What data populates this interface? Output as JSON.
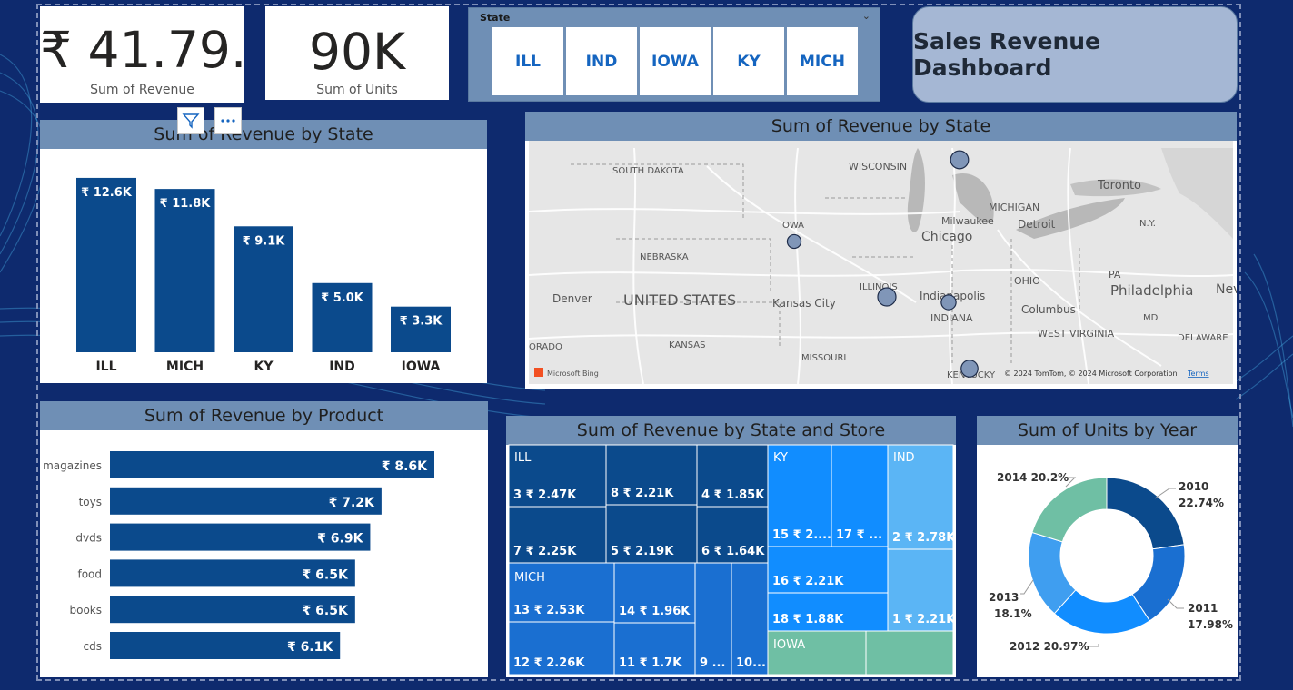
{
  "kpis": [
    {
      "value": "₹ 41.79...",
      "label": "Sum of Revenue"
    },
    {
      "value": "90K",
      "label": "Sum of Units"
    }
  ],
  "slicer": {
    "label": "State",
    "options": [
      "ILL",
      "IND",
      "IOWA",
      "KY",
      "MICH"
    ]
  },
  "dashboard_title": "Sales Revenue Dashboard",
  "icons": {
    "filter": "filter-icon",
    "more": "more-options-icon",
    "chevron": "chevron-down-icon"
  },
  "map": {
    "title": "Sum of Revenue by State",
    "labels": [
      "SOUTH DAKOTA",
      "WISCONSIN",
      "MICHIGAN",
      "Toronto",
      "IOWA",
      "Milwaukee",
      "Chicago",
      "Detroit",
      "N.Y.",
      "NEBRASKA",
      "ILLINOIS",
      "OHIO",
      "PA",
      "Denver",
      "UNITED STATES",
      "Kansas City",
      "Indianapolis",
      "Philadelphia",
      "Columbus",
      "INDIANA",
      "MD",
      "KANSAS",
      "WEST VIRGINIA",
      "DELAWARE",
      "MISSOURI",
      "ORADO",
      "KENTUCKY",
      "Nev"
    ],
    "bubbles": [
      {
        "state": "MICH",
        "value": 11800
      },
      {
        "state": "IOWA",
        "value": 3300
      },
      {
        "state": "ILL",
        "value": 12600
      },
      {
        "state": "IND",
        "value": 5000
      },
      {
        "state": "KY",
        "value": 9100
      }
    ],
    "logo": "Microsoft Bing",
    "attribution": "© 2024 TomTom, © 2024 Microsoft Corporation",
    "terms": "Terms"
  },
  "chart_data": [
    {
      "type": "bar",
      "title": "Sum of Revenue by State",
      "categories": [
        "ILL",
        "MICH",
        "KY",
        "IND",
        "IOWA"
      ],
      "values": [
        12600,
        11800,
        9100,
        5000,
        3300
      ],
      "data_labels": [
        "₹ 12.6K",
        "₹ 11.8K",
        "₹ 9.1K",
        "₹ 5.0K",
        "₹ 3.3K"
      ],
      "xlabel": "",
      "ylabel": ""
    },
    {
      "type": "bar",
      "orientation": "horizontal",
      "title": "Sum of Revenue by Product",
      "categories": [
        "magazines",
        "toys",
        "dvds",
        "food",
        "books",
        "cds"
      ],
      "values": [
        8600,
        7200,
        6900,
        6500,
        6500,
        6100
      ],
      "data_labels": [
        "₹ 8.6K",
        "₹ 7.2K",
        "₹ 6.9K",
        "₹ 6.5K",
        "₹ 6.5K",
        "₹ 6.1K"
      ]
    },
    {
      "type": "treemap",
      "title": "Sum of Revenue by State and Store",
      "groups": [
        {
          "state": "ILL",
          "color": "#0b4a8c",
          "stores": [
            {
              "label": "3 ₹ 2.47K",
              "value": 2470
            },
            {
              "label": "7 ₹ 2.25K",
              "value": 2250
            },
            {
              "label": "8 ₹ 2.21K",
              "value": 2210
            },
            {
              "label": "5 ₹ 2.19K",
              "value": 2190
            },
            {
              "label": "4 ₹ 1.85K",
              "value": 1850
            },
            {
              "label": "6 ₹ 1.64K",
              "value": 1640
            }
          ]
        },
        {
          "state": "MICH",
          "color": "#1a6fd1",
          "stores": [
            {
              "label": "13 ₹ 2.53K",
              "value": 2530
            },
            {
              "label": "12 ₹ 2.26K",
              "value": 2260
            },
            {
              "label": "14 ₹ 1.96K",
              "value": 1960
            },
            {
              "label": "11 ₹ 1.7K",
              "value": 1700
            },
            {
              "label": "9 ...",
              "value": null
            },
            {
              "label": "10...",
              "value": null
            }
          ]
        },
        {
          "state": "KY",
          "color": "#118dff",
          "stores": [
            {
              "label": "15 ₹ 2....",
              "value": null
            },
            {
              "label": "17 ₹ ...",
              "value": null
            },
            {
              "label": "16 ₹ 2.21K",
              "value": 2210
            },
            {
              "label": "18 ₹ 1.88K",
              "value": 1880
            }
          ]
        },
        {
          "state": "IND",
          "color": "#5bb5f5",
          "stores": [
            {
              "label": "2 ₹ 2.78K",
              "value": 2780
            },
            {
              "label": "1 ₹ 2.21K",
              "value": 2210
            }
          ]
        },
        {
          "state": "IOWA",
          "color": "#6fbfa4",
          "stores": []
        }
      ]
    },
    {
      "type": "pie",
      "donut": true,
      "title": "Sum of Units by Year",
      "categories": [
        "2010",
        "2011",
        "2012",
        "2013",
        "2014"
      ],
      "values": [
        22.74,
        17.98,
        20.97,
        18.1,
        20.2
      ],
      "data_labels": [
        "22.74%",
        "17.98%",
        "20.97%",
        "18.1%",
        "20.2%"
      ],
      "colors": [
        "#0b4a8c",
        "#1a6fd1",
        "#118dff",
        "#3f9ef0",
        "#6fbfa4"
      ]
    }
  ]
}
